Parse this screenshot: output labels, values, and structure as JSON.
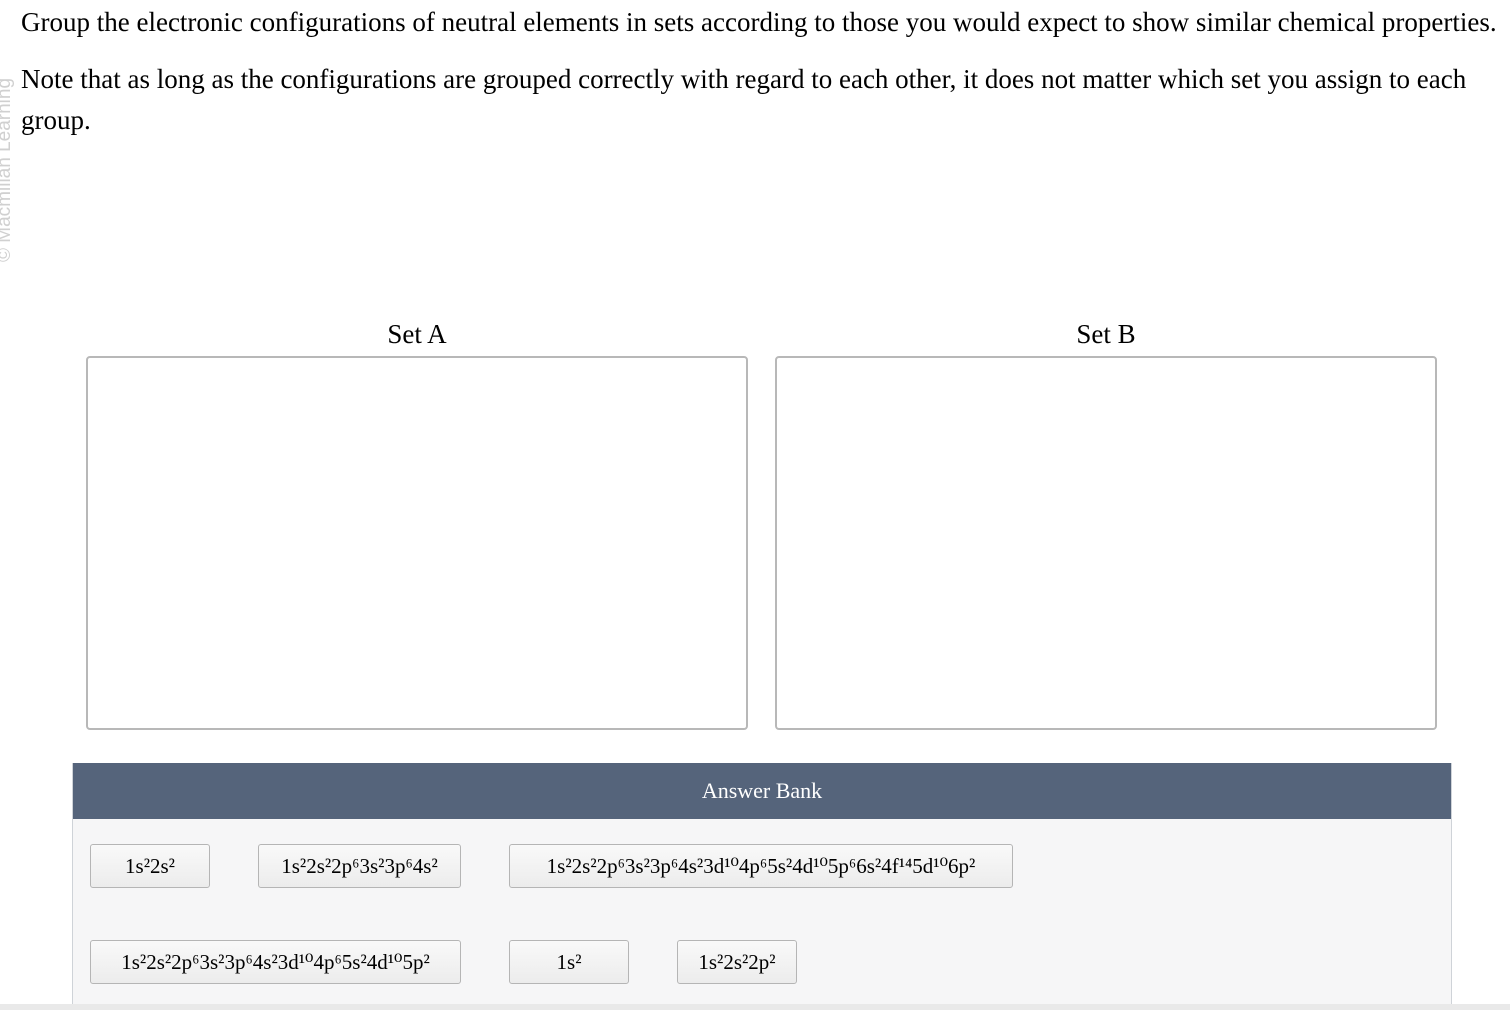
{
  "watermark": "© Macmillan Learning",
  "instructions": {
    "line1": "Group the electronic configurations of neutral elements in sets according to those you would expect to show similar chemical properties.",
    "line2": "Note that as long as the configurations are grouped correctly with regard to each other, it does not matter which set you assign to each group."
  },
  "sets": {
    "a": "Set A",
    "b": "Set B"
  },
  "answer_bank": {
    "title": "Answer Bank",
    "items": [
      "1s²2s²",
      "1s²2s²2p⁶3s²3p⁶4s²",
      "1s²2s²2p⁶3s²3p⁶4s²3d¹⁰4p⁶5s²4d¹⁰5p⁶6s²4f¹⁴5d¹⁰6p²",
      "1s²2s²2p⁶3s²3p⁶4s²3d¹⁰4p⁶5s²4d¹⁰5p²",
      "1s²",
      "1s²2s²2p²"
    ]
  }
}
